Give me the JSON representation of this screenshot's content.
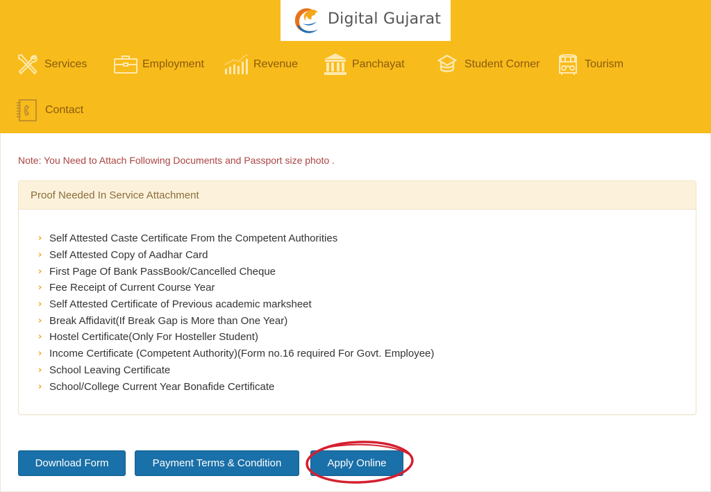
{
  "header": {
    "logo_text": "Digital Gujarat",
    "background_color": "#f8bb1c",
    "nav": [
      {
        "label": "Services",
        "icon": "tools-icon"
      },
      {
        "label": "Employment",
        "icon": "briefcase-icon"
      },
      {
        "label": "Revenue",
        "icon": "chart-icon"
      },
      {
        "label": "Panchayat",
        "icon": "building-icon"
      },
      {
        "label": "Student Corner",
        "icon": "graduation-cap-icon"
      },
      {
        "label": "Tourism",
        "icon": "bus-icon"
      },
      {
        "label": "Contact",
        "icon": "phonebook-icon"
      }
    ]
  },
  "main": {
    "note": "Note: You Need to Attach Following Documents and Passport size photo .",
    "panel": {
      "heading": "Proof Needed In Service Attachment",
      "documents": [
        "Self Attested Caste Certificate From the Competent Authorities",
        "Self Attested Copy of Aadhar Card",
        "First Page Of Bank PassBook/Cancelled Cheque",
        "Fee Receipt of Current Course Year",
        "Self Attested Certificate of Previous academic marksheet",
        "Break Affidavit(If Break Gap is More than One Year)",
        "Hostel Certificate(Only For Hosteller Student)",
        "Income Certificate (Competent Authority)(Form no.16 required For Govt. Employee)",
        "School Leaving Certificate",
        "School/College Current Year Bonafide Certificate"
      ]
    },
    "buttons": {
      "download": "Download Form",
      "payment": "Payment Terms & Condition",
      "apply": "Apply Online"
    },
    "accent_color": "#1a70a8",
    "highlight_color": "#d42030"
  }
}
